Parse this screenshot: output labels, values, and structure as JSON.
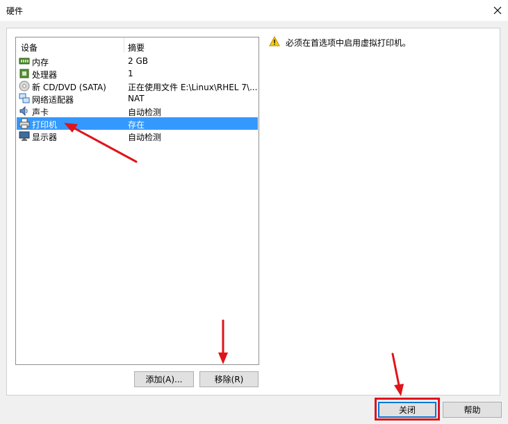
{
  "window": {
    "title": "硬件"
  },
  "device_list": {
    "columns": {
      "device": "设备",
      "summary": "摘要"
    },
    "rows": [
      {
        "icon": "memory-icon",
        "name": "内存",
        "summary": "2 GB"
      },
      {
        "icon": "processor-icon",
        "name": "处理器",
        "summary": "1"
      },
      {
        "icon": "cd-dvd-icon",
        "name": "新 CD/DVD (SATA)",
        "summary": "正在使用文件 E:\\Linux\\RHEL 7\\..."
      },
      {
        "icon": "network-adapter-icon",
        "name": "网络适配器",
        "summary": "NAT"
      },
      {
        "icon": "sound-card-icon",
        "name": "声卡",
        "summary": "自动检测"
      },
      {
        "icon": "printer-icon",
        "name": "打印机",
        "summary": "存在",
        "selected": true
      },
      {
        "icon": "display-icon",
        "name": "显示器",
        "summary": "自动检测"
      }
    ]
  },
  "buttons": {
    "add": "添加(A)...",
    "remove": "移除(R)",
    "close": "关闭",
    "help": "帮助"
  },
  "message": {
    "icon": "warning-icon",
    "text": "必须在首选项中启用虚拟打印机。"
  },
  "colors": {
    "selection": "#3399ff",
    "annotation": "#e0131b",
    "focus": "#0078d7"
  }
}
